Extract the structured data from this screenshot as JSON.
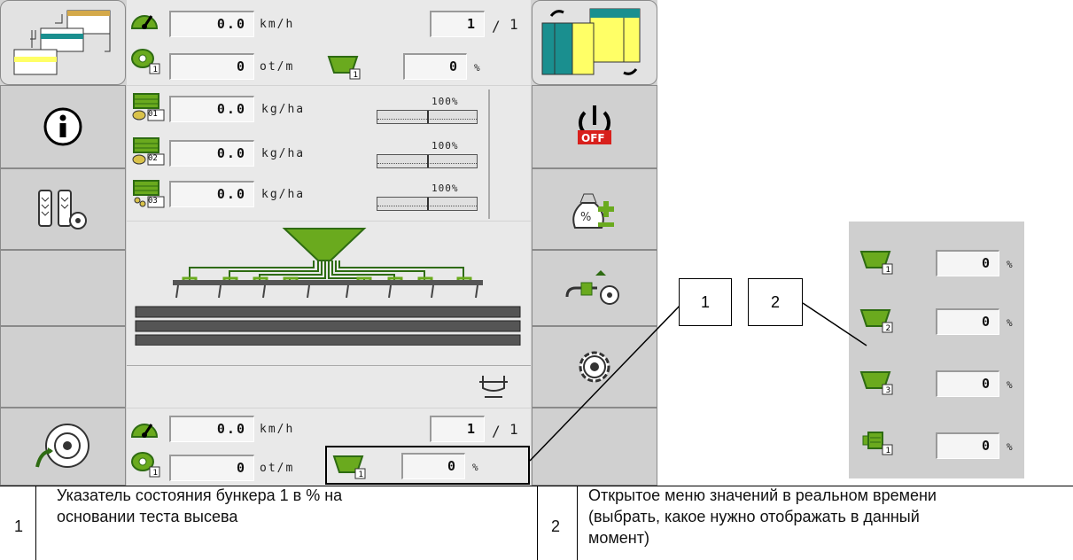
{
  "header": {
    "speed_value": "0.0",
    "speed_unit": "km/h",
    "section_current": "1",
    "section_sep": "/",
    "section_total": "1",
    "rpm_value": "0",
    "rpm_unit": "ot/m",
    "hopper_pct": "0",
    "pct_unit": "%"
  },
  "products": [
    {
      "index": "01",
      "value": "0.0",
      "unit": "kg/ha",
      "pct_label": "100%"
    },
    {
      "index": "02",
      "value": "0.0",
      "unit": "kg/ha",
      "pct_label": "100%"
    },
    {
      "index": "03",
      "value": "0.0",
      "unit": "kg/ha",
      "pct_label": "100%"
    }
  ],
  "footer": {
    "speed_value": "0.0",
    "speed_unit": "km/h",
    "section_current": "1",
    "section_sep": "/",
    "section_total": "1",
    "rpm_value": "0",
    "rpm_unit": "ot/m",
    "hopper_pct": "0",
    "pct_unit": "%"
  },
  "hopper_menu": [
    {
      "index": "1",
      "value": "0",
      "unit": "%"
    },
    {
      "index": "2",
      "value": "0",
      "unit": "%"
    },
    {
      "index": "3",
      "value": "0",
      "unit": "%"
    },
    {
      "index": "1",
      "value": "0",
      "unit": "%"
    }
  ],
  "callouts": {
    "one": "1",
    "two": "2"
  },
  "legend": {
    "num1": "1",
    "text1_line1": "Указатель состояния бункера 1 в % на",
    "text1_line2": "основании теста высева",
    "num2": "2",
    "text2_line1": "Открытое меню значений в реальном времени",
    "text2_line2": "(выбрать, какое нужно отображать в данный",
    "text2_line3": "момент)"
  },
  "status": {
    "off_badge": "OFF",
    "percent_sign": "%"
  },
  "colors": {
    "accent_green": "#6aaa1e",
    "dark_green": "#2e6b12",
    "yellow": "#ffff66",
    "teal": "#1a8f8f",
    "off_red": "#d8201c"
  },
  "icons": [
    "workflow-icon",
    "screen-switch-icon",
    "info-icon",
    "tramline-settings-icon",
    "power-off-icon",
    "calibration-bag-icon",
    "hydraulics-settings-icon",
    "gear-icon",
    "wheel-icon",
    "speedometer-icon",
    "fan-icon",
    "hopper-icon",
    "metering-unit-icon",
    "seed-icon",
    "fertilizer-icon",
    "drill-diagram-icon",
    "tractor-hitch-icon"
  ]
}
